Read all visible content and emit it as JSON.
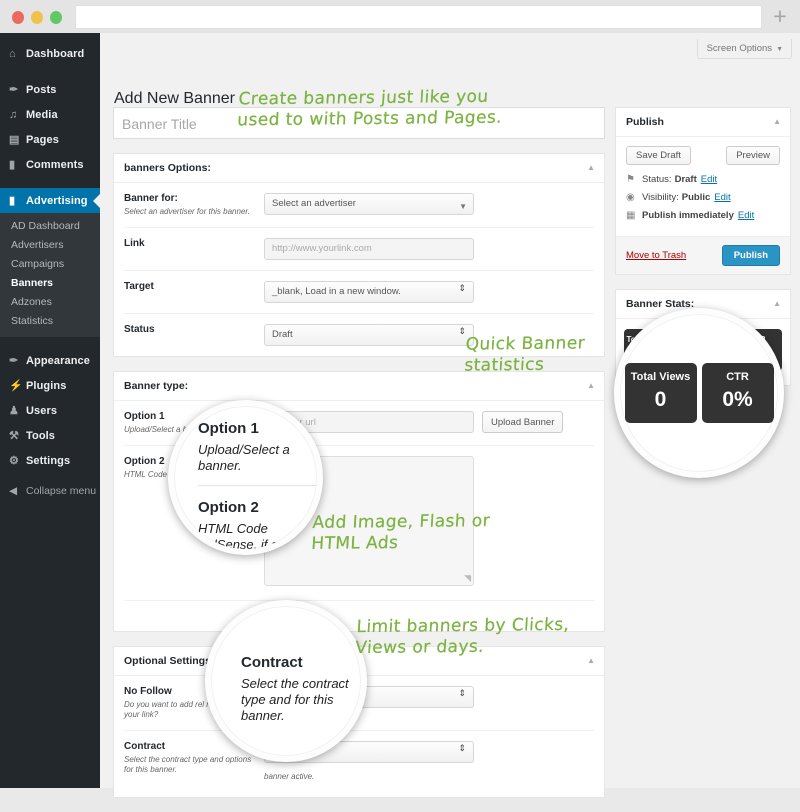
{
  "browser": {
    "url_value": "",
    "new_tab_icon": "plus-icon"
  },
  "sidebar": {
    "top_items": [
      {
        "label": "Dashboard",
        "icon": "dashboard-icon",
        "glyph": "⌂"
      },
      {
        "label": "Posts",
        "icon": "pin-icon",
        "glyph": "✒"
      },
      {
        "label": "Media",
        "icon": "media-icon",
        "glyph": "♫"
      },
      {
        "label": "Pages",
        "icon": "page-icon",
        "glyph": "☰"
      },
      {
        "label": "Comments",
        "icon": "comment-icon",
        "glyph": "▭"
      },
      {
        "label": "Advertising",
        "icon": "advertising-icon",
        "glyph": "▮",
        "current": true
      }
    ],
    "submenu": [
      {
        "label": "AD Dashboard"
      },
      {
        "label": "Advertisers"
      },
      {
        "label": "Campaigns"
      },
      {
        "label": "Banners",
        "current": true
      },
      {
        "label": "Adzones"
      },
      {
        "label": "Statistics"
      }
    ],
    "bottom_items": [
      {
        "label": "Appearance",
        "icon": "brush-icon",
        "glyph": "✎"
      },
      {
        "label": "Plugins",
        "icon": "plug-icon",
        "glyph": "⚡"
      },
      {
        "label": "Users",
        "icon": "user-icon",
        "glyph": "♟"
      },
      {
        "label": "Tools",
        "icon": "wrench-icon",
        "glyph": "⚒"
      },
      {
        "label": "Settings",
        "icon": "gear-icon",
        "glyph": "⚙"
      }
    ],
    "collapse": {
      "label": "Collapse menu",
      "icon": "collapse-icon",
      "glyph": "◀"
    }
  },
  "screen_options": {
    "label": "Screen Options",
    "caret": "▼"
  },
  "page": {
    "title": "Add New Banner"
  },
  "title_field": {
    "placeholder": "Banner Title",
    "value": ""
  },
  "banner_options": {
    "heading": "banners Options:",
    "toggle_icon": "▲",
    "rows": [
      {
        "label": "Banner for:",
        "desc": "Select an advertiser for this banner.",
        "control": "select",
        "value": "Select an advertiser"
      },
      {
        "label": "Link",
        "desc": "",
        "control": "input",
        "value": "http://www.yourlink.com"
      },
      {
        "label": "Target",
        "desc": "",
        "control": "select-stepper",
        "value": "_blank, Load in a new window."
      },
      {
        "label": "Status",
        "desc": "",
        "control": "select-stepper",
        "value": "Draft"
      }
    ]
  },
  "banner_type": {
    "heading": "Banner type:",
    "toggle_icon": "▲",
    "option1": {
      "label": "Option 1",
      "desc": "Upload/Select a banner.",
      "input_placeholder": "Banner url",
      "upload_button": "Upload Banner"
    },
    "option2": {
      "label": "Option 2",
      "desc": "HTML Code (adSense, if ads, ...)",
      "textarea_value": ""
    },
    "option3": {
      "label": "",
      "desc": ""
    }
  },
  "optional_settings": {
    "heading": "Optional Settings:",
    "toggle_icon": "▲",
    "rows": [
      {
        "label": "No Follow",
        "desc": "Do you want to add rel nofollow to your link?",
        "value": ""
      },
      {
        "label": "Contract",
        "desc": "Select the contract type and options for this banner.",
        "value": "",
        "hint": "banner active."
      }
    ]
  },
  "publish_box": {
    "heading": "Publish",
    "toggle_icon": "▲",
    "save_draft": "Save Draft",
    "preview": "Preview",
    "lines": [
      {
        "icon": "pin-icon",
        "glyph": "⚑",
        "text": "Status:",
        "strong": "Draft",
        "link": "Edit"
      },
      {
        "icon": "eye-icon",
        "glyph": "◉",
        "text": "Visibility:",
        "strong": "Public",
        "link": "Edit"
      },
      {
        "icon": "calendar-icon",
        "glyph": "☷",
        "text": "",
        "strong": "Publish immediately",
        "link": "Edit"
      }
    ],
    "move_to_trash": "Move to Trash",
    "publish": "Publish"
  },
  "stats_box": {
    "heading": "Banner Stats:",
    "toggle_icon": "▲",
    "tiles": [
      {
        "label": "Total Clicks",
        "value": "0"
      },
      {
        "label": "Total Views",
        "value": "0"
      },
      {
        "label": "CTR",
        "value": "0%"
      }
    ]
  },
  "magnifiers": {
    "options": {
      "head1": "Option 1",
      "sub1": "Upload/Select a banner.",
      "head2": "Option 2",
      "sub2": "HTML Code (adSense, if ads, ...)"
    },
    "contract": {
      "head": "Contract",
      "sub": "Select the contract type and for this banner."
    },
    "stats": {
      "tiles": [
        {
          "label": "Total Views",
          "value": "0"
        },
        {
          "label": "CTR",
          "value": "0%"
        }
      ]
    }
  },
  "annotations": [
    {
      "id": "anno-create-banners",
      "text": "Create banners just like you\nused to with Posts and Pages."
    },
    {
      "id": "anno-quick-stats",
      "text": "Quick Banner\n    statistics"
    },
    {
      "id": "anno-add-image",
      "text": "Add Image, Flash or\nHTML Ads"
    },
    {
      "id": "anno-limit-banners",
      "text": "Limit banners by Clicks,\n   Views or days."
    }
  ],
  "colors": {
    "accent_blue": "#0073aa",
    "publish_blue": "#2a95c5",
    "handwriting_green": "#7cb342",
    "sidebar_dark": "#23282d",
    "submenu_dark": "#32373c",
    "trash_red": "#a00",
    "stat_tile": "#333333"
  }
}
